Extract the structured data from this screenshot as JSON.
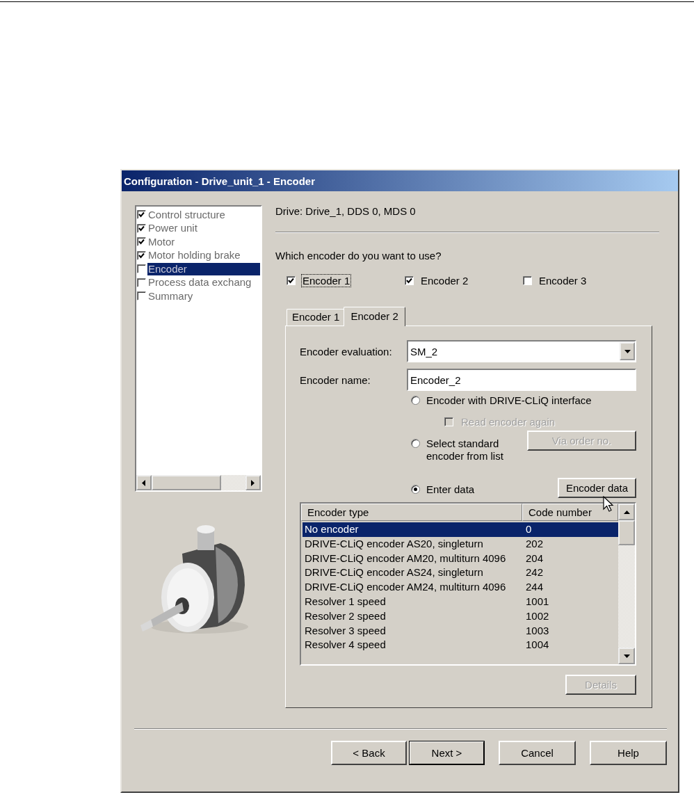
{
  "window": {
    "title": "Configuration - Drive_unit_1 - Encoder"
  },
  "steps": [
    {
      "label": "Control structure",
      "checked": true,
      "selected": false
    },
    {
      "label": "Power unit",
      "checked": true,
      "selected": false
    },
    {
      "label": "Motor",
      "checked": true,
      "selected": false
    },
    {
      "label": "Motor holding brake",
      "checked": true,
      "selected": false
    },
    {
      "label": "Encoder",
      "checked": false,
      "selected": true
    },
    {
      "label": "Process data exchang",
      "checked": false,
      "selected": false
    },
    {
      "label": "Summary",
      "checked": false,
      "selected": false
    }
  ],
  "drive_info": "Drive: Drive_1, DDS 0, MDS 0",
  "question": "Which encoder do you want to use?",
  "encoder_choices": [
    {
      "label": "Encoder 1",
      "checked": true,
      "focused": true
    },
    {
      "label": "Encoder 2",
      "checked": true,
      "focused": false
    },
    {
      "label": "Encoder 3",
      "checked": false,
      "focused": false
    }
  ],
  "tabs": [
    {
      "label": "Encoder 1",
      "selected": false
    },
    {
      "label": "Encoder 2",
      "selected": true
    }
  ],
  "evaluation": {
    "label": "Encoder evaluation:",
    "value": "SM_2"
  },
  "encoder_name": {
    "label": "Encoder name:",
    "value": "Encoder_2"
  },
  "source_options": [
    {
      "label": "Encoder with DRIVE-CLiQ interface",
      "selected": false,
      "checkbox": {
        "label": "Read encoder again",
        "checked": false,
        "disabled": true
      }
    },
    {
      "label": "Select standard encoder from list",
      "selected": false,
      "button": {
        "label": "Via order no.",
        "disabled": true
      }
    },
    {
      "label": "Enter data",
      "selected": true,
      "button": {
        "label": "Encoder data",
        "disabled": false
      }
    }
  ],
  "table": {
    "columns": [
      "Encoder type",
      "Code number"
    ],
    "rows": [
      {
        "cells": [
          "No encoder",
          "0"
        ],
        "selected": true
      },
      {
        "cells": [
          "DRIVE-CLiQ encoder AS20, singleturn",
          "202"
        ],
        "selected": false
      },
      {
        "cells": [
          "DRIVE-CLiQ encoder AM20, multiturn 4096",
          "204"
        ],
        "selected": false
      },
      {
        "cells": [
          "DRIVE-CLiQ encoder AS24, singleturn",
          "242"
        ],
        "selected": false
      },
      {
        "cells": [
          "DRIVE-CLiQ encoder AM24, multiturn 4096",
          "244"
        ],
        "selected": false
      },
      {
        "cells": [
          "Resolver 1 speed",
          "1001"
        ],
        "selected": false
      },
      {
        "cells": [
          "Resolver 2 speed",
          "1002"
        ],
        "selected": false
      },
      {
        "cells": [
          "Resolver 3 speed",
          "1003"
        ],
        "selected": false
      },
      {
        "cells": [
          "Resolver 4 speed",
          "1004"
        ],
        "selected": false
      }
    ]
  },
  "details_button": {
    "label": "Details",
    "disabled": true
  },
  "buttons": [
    {
      "label": "< Back",
      "default": false
    },
    {
      "label": "Next >",
      "default": true
    },
    {
      "label": "Cancel",
      "default": false
    },
    {
      "label": "Help",
      "default": false
    }
  ]
}
